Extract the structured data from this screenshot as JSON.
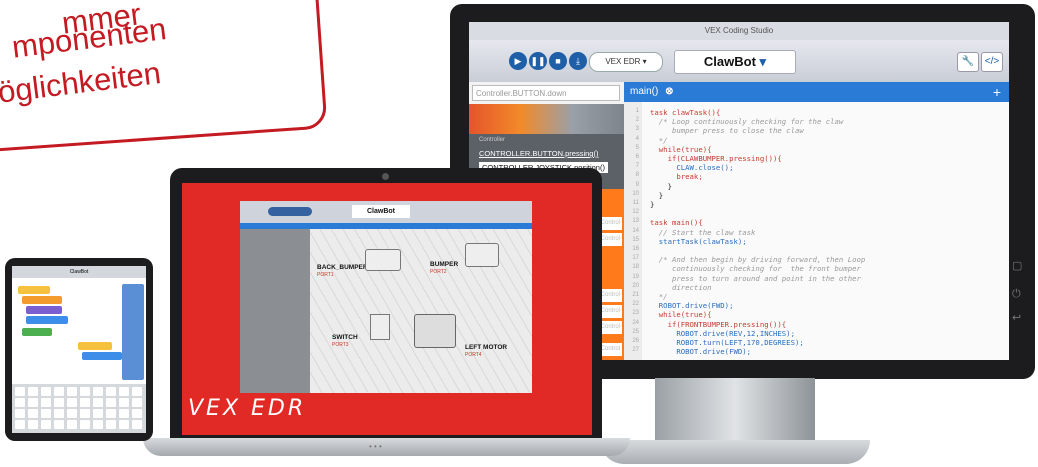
{
  "badge": {
    "line1": "mmer",
    "line2": "mponenten",
    "line3": "öglichkeiten",
    "color": "#c41a22"
  },
  "monitor": {
    "window_title": "VEX Coding Studio",
    "toolbar": {
      "play_icon": "play-icon",
      "pause_icon": "pause-icon",
      "stop_icon": "stop-icon",
      "download_icon": "download-icon",
      "platform": "VEX EDR",
      "project_name": "ClawBot"
    },
    "search_placeholder": "Controller.BUTTON.down",
    "panel_heading": "Controller",
    "controller_items": [
      "CONTROLLER.BUTTON.pressing()",
      "CONTROLLER.JOYSTICK.position()"
    ],
    "block_rows": [
      "value",
      "ue",
      "vent, task )",
      "E )(...)",
      ")",
      "ndition )"
    ],
    "block_hint": "Control",
    "tab_label": "main()",
    "code_lines": [
      "task clawTask(){",
      "  /* Loop continuously checking for the claw",
      "     bumper press to close the claw",
      "  */",
      "  while(true){",
      "    if(CLAWBUMPER.pressing()){",
      "      CLAW.close();",
      "      break;",
      "    }",
      "  }",
      "}",
      "",
      "task main(){",
      "  // Start the claw task",
      "  startTask(clawTask);",
      "",
      "  /* And then begin by driving forward, then Loop",
      "     continuously checking for  the front bumper",
      "     press to turn around and point in the other",
      "     direction",
      "  */",
      "  ROBOT.drive(FWD);",
      "  while(true){",
      "    if(FRONTBUMPER.pressing()){",
      "      ROBOT.drive(REV,12,INCHES);",
      "      ROBOT.turn(LEFT,170,DEGREES);",
      "      ROBOT.drive(FWD);"
    ],
    "line_numbers": [
      "1",
      "2",
      "3",
      "4",
      "5",
      "6",
      "7",
      "8",
      "9",
      "10",
      "11",
      "12",
      "13",
      "14",
      "15",
      "16",
      "17",
      "18",
      "19",
      "20",
      "21",
      "22",
      "23",
      "24",
      "25",
      "26",
      "27"
    ]
  },
  "laptop": {
    "project_name": "ClawBot",
    "labels": {
      "back_bumper": "BACK_BUMPER",
      "bumper": "BUMPER",
      "switch": "SWITCH",
      "left_motor": "LEFT MOTOR"
    },
    "port_labels": {
      "back_bumper": "PORT1",
      "bumper": "PORT2",
      "switch": "PORT3",
      "left_motor": "PORT4"
    },
    "logo": "VEX EDR"
  },
  "tablet": {
    "project_name": "ClawBot"
  }
}
